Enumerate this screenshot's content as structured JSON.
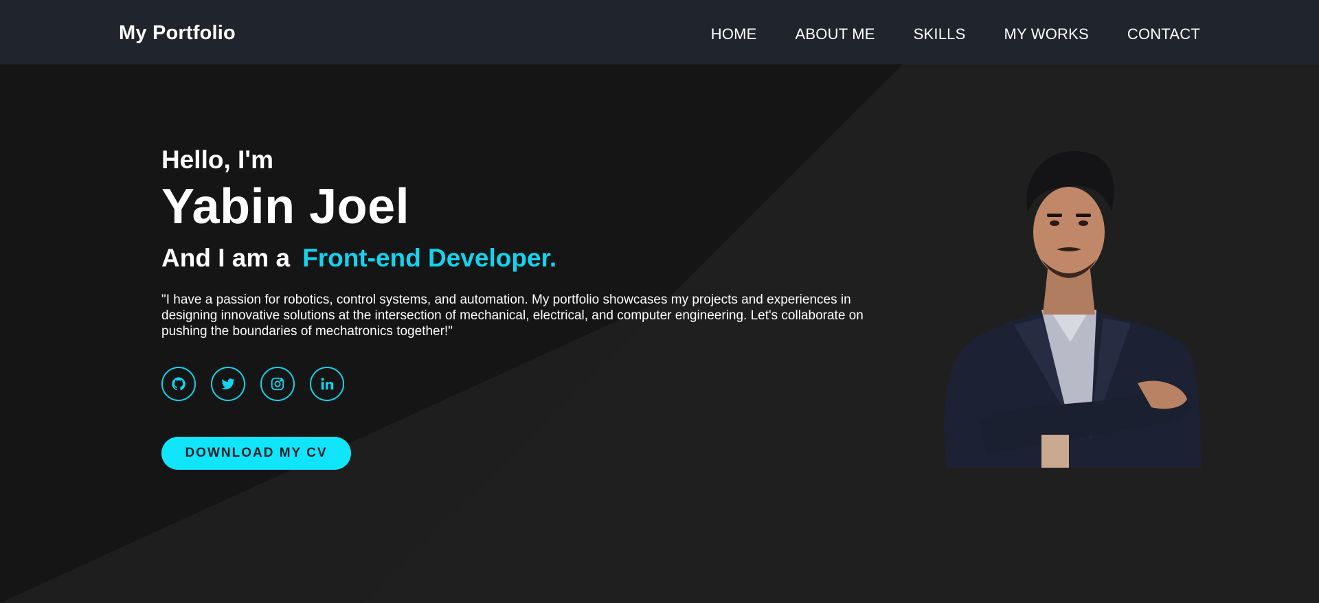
{
  "navbar": {
    "brand": "My Portfolio",
    "links": [
      {
        "label": "HOME"
      },
      {
        "label": "ABOUT ME"
      },
      {
        "label": "SKILLS"
      },
      {
        "label": "MY WORKS"
      },
      {
        "label": "CONTACT"
      }
    ]
  },
  "hero": {
    "greeting": "Hello, I'm",
    "name": "Yabin Joel",
    "role_prefix": "And I am a",
    "role_highlight": "Front-end Developer.",
    "bio": "\"I have a passion for robotics, control systems, and automation. My portfolio showcases my projects and experiences in designing innovative solutions at the intersection of mechanical, electrical, and computer engineering. Let's collaborate on pushing the boundaries of mechatronics together!\"",
    "socials": [
      {
        "icon": "github-icon"
      },
      {
        "icon": "twitter-icon"
      },
      {
        "icon": "instagram-icon"
      },
      {
        "icon": "linkedin-icon"
      }
    ],
    "cta_label": "DOWNLOAD MY CV"
  },
  "colors": {
    "accent": "#13d4ef",
    "cta_bg": "#10e5fb",
    "navbar_bg": "#20242c",
    "page_bg": "#161616"
  }
}
